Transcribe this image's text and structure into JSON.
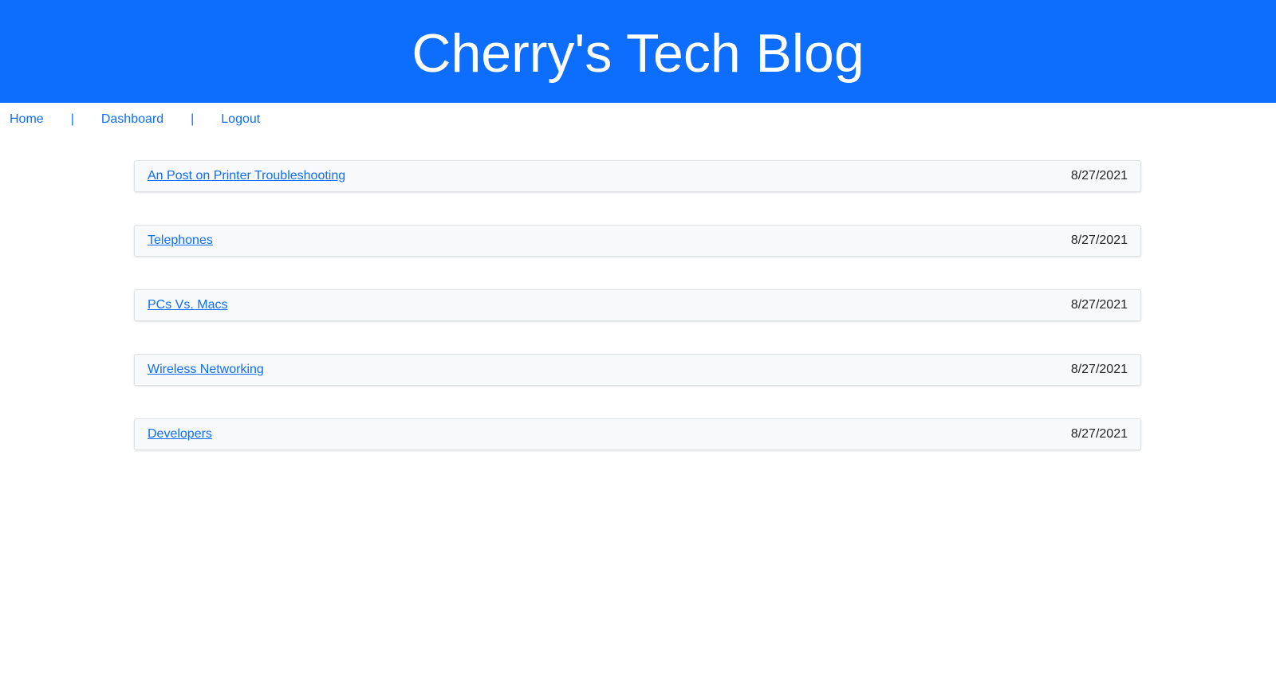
{
  "header": {
    "title": "Cherry's Tech Blog"
  },
  "nav": {
    "home": "Home",
    "separator": "|",
    "dashboard": "Dashboard",
    "logout": "Logout"
  },
  "posts": [
    {
      "title": "An Post on Printer Troubleshooting",
      "date": "8/27/2021"
    },
    {
      "title": "Telephones",
      "date": "8/27/2021"
    },
    {
      "title": "PCs Vs. Macs",
      "date": "8/27/2021"
    },
    {
      "title": "Wireless Networking",
      "date": "8/27/2021"
    },
    {
      "title": "Developers",
      "date": "8/27/2021"
    }
  ],
  "colors": {
    "brand": "#0d6efd",
    "card_bg": "#f8f9fa"
  }
}
